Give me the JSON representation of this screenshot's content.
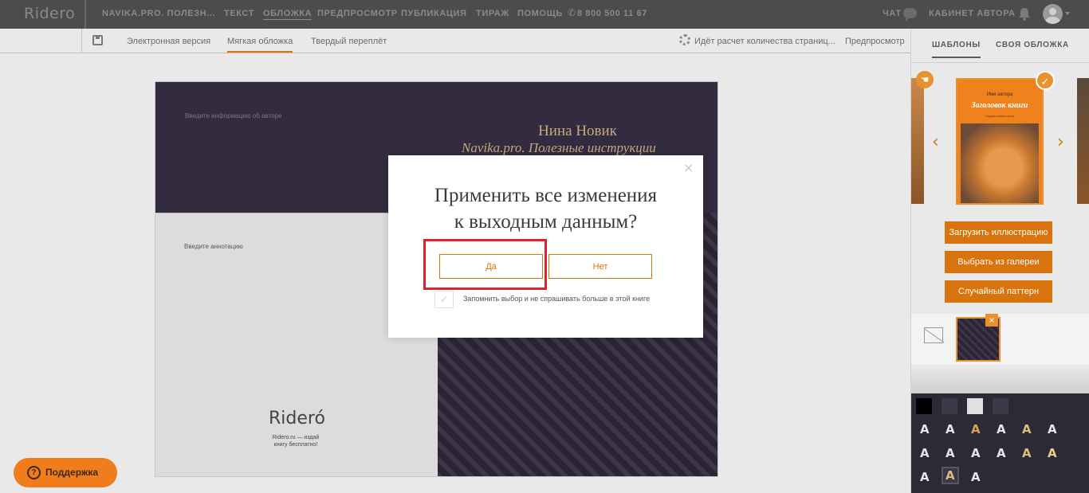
{
  "header": {
    "logo": "Ridero",
    "book": "NAVIKA.PRO. ПОЛЕЗН...",
    "nav": [
      "ТЕКСТ",
      "ОБЛОЖКА",
      "ПРЕДПРОСМОТР",
      "ПУБЛИКАЦИЯ",
      "ТИРАЖ",
      "ПОМОЩЬ"
    ],
    "active_nav": "ОБЛОЖКА",
    "phone": "8 800 500 11 67",
    "chat": "ЧАТ",
    "cabinet": "КАБИНЕТ АВТОРА"
  },
  "subbar": {
    "tabs": [
      "Электронная версия",
      "Мягкая обложка",
      "Твердый переплёт"
    ],
    "active_tab": "Мягкая обложка",
    "status": "Идёт расчет количества страниц...",
    "preview": "Предпросмотр"
  },
  "cover": {
    "author_info_placeholder": "Введите информацию об авторе",
    "author": "Нина Новик",
    "title": "Navika.pro. Полезные инструкции",
    "annotation_placeholder": "Введите аннотацию",
    "ridero_mark": "Rideró",
    "ridero_sub": "Ridero.ru — издай книгу бесплатно!"
  },
  "modal": {
    "title_line1": "Применить все изменения",
    "title_line2": "к выходным данным?",
    "yes": "Да",
    "no": "Нет",
    "remember": "Запомнить выбор и не спрашивать больше в этой книге",
    "close": "×"
  },
  "support": {
    "label": "Поддержка"
  },
  "right_panel": {
    "tabs": [
      "ШАБЛОНЫ",
      "СВОЯ ОБЛОЖКА"
    ],
    "active_tab": "ШАБЛОНЫ",
    "template": {
      "author": "Имя автора",
      "title": "Заголовок книги",
      "subtitle": "Подзаголовок книги"
    },
    "buttons": [
      "Загрузить иллюстрацию",
      "Выбрать из галереи",
      "Случайный паттерн"
    ],
    "swatches": [
      "#000000",
      "#3b3a48",
      "#e0e0e0",
      "#3b3a48"
    ],
    "font_letter": "A",
    "font_colors_row1": [
      "#e6e6e6",
      "#e6e6e6",
      "#d9a15a",
      "#e6e6e6",
      "#d8c07a",
      "#e6e6e6"
    ],
    "font_colors_row2": [
      "#e6e6e6",
      "#e6e6e6",
      "#e6e6e6",
      "#e6e6e6",
      "#d8c07a",
      "#e6d08a"
    ],
    "font_colors_row3": [
      "#e6e6e6",
      "#d8c07a",
      "#e6e6e6"
    ]
  },
  "colors": {
    "accent": "#d9730d",
    "header_bg": "#4c4c4c",
    "highlight": "#e0222e"
  }
}
